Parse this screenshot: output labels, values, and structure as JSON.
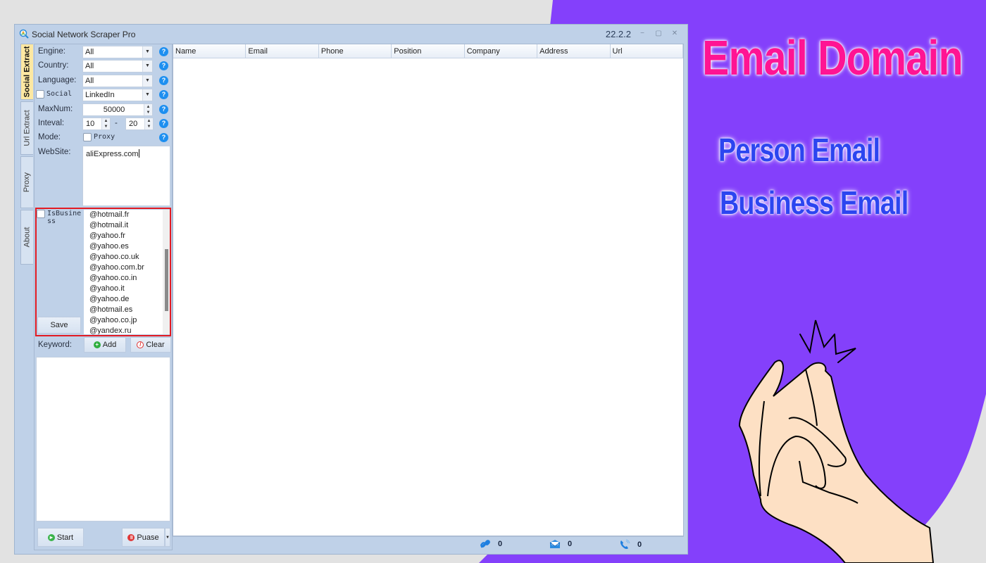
{
  "window": {
    "title": "Social Network Scraper Pro",
    "version": "22.2.2",
    "controls": {
      "minimize": "−",
      "maximize": "▢",
      "close": "✕"
    }
  },
  "side_tabs": [
    {
      "label": "Social Extract",
      "active": true
    },
    {
      "label": "Url Extract",
      "active": false
    },
    {
      "label": "Proxy",
      "active": false
    },
    {
      "label": "About",
      "active": false
    }
  ],
  "form": {
    "engine": {
      "label": "Engine:",
      "value": "All"
    },
    "country": {
      "label": "Country:",
      "value": "All"
    },
    "language": {
      "label": "Language:",
      "value": "All"
    },
    "social": {
      "label": "Social",
      "checked": false,
      "value": "LinkedIn"
    },
    "maxnum": {
      "label": "MaxNum:",
      "value": "50000"
    },
    "interval": {
      "label": "Inteval:",
      "from": "10",
      "separator": "-",
      "to": "20"
    },
    "mode": {
      "label": "Mode:",
      "proxy_label": "Proxy",
      "proxy_checked": false
    },
    "website": {
      "label": "WebSite:",
      "value": "aliExpress.com"
    },
    "help_glyph": "?"
  },
  "business": {
    "checkbox_label": "IsBusiness",
    "checked": false,
    "save_label": "Save",
    "domains": [
      "@hotmail.fr",
      "@hotmail.it",
      "@yahoo.fr",
      "@yahoo.es",
      "@yahoo.co.uk",
      "@yahoo.com.br",
      "@yahoo.co.in",
      "@yahoo.it",
      "@yahoo.de",
      "@hotmail.es",
      "@yahoo.co.jp",
      "@yandex.ru"
    ]
  },
  "keyword": {
    "label": "Keyword:",
    "add_label": "Add",
    "clear_label": "Clear",
    "value": ""
  },
  "actions": {
    "start_label": "Start",
    "pause_label": "Puase"
  },
  "table": {
    "columns": [
      "Name",
      "Email",
      "Phone",
      "Position",
      "Company",
      "Address",
      "Url"
    ],
    "rows": []
  },
  "status_bar": {
    "links": "0",
    "emails": "0",
    "phones": "0"
  },
  "promo": {
    "title": "Email Domain",
    "line1": "Person Email",
    "line2": "Business Email",
    "colors": {
      "background": "#8440fb",
      "title": "#ff1493",
      "subtitle": "#2c45f0"
    }
  }
}
